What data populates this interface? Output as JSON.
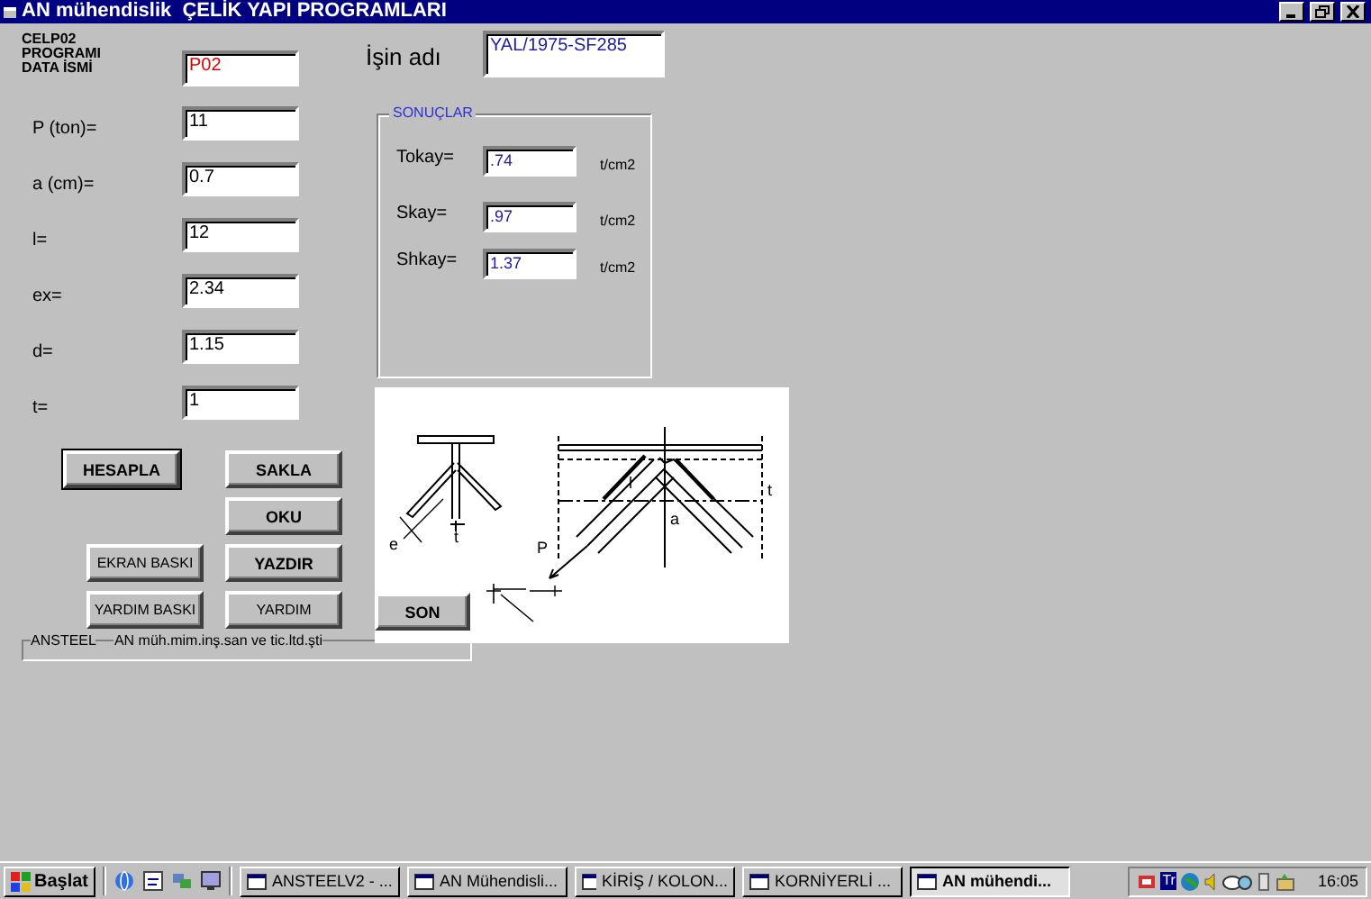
{
  "window": {
    "title": "AN mühendislik  ÇELİK YAPI PROGRAMLARI"
  },
  "data_name": {
    "label_lines": [
      "CELP02",
      "PROGRAMI",
      "DATA  İSMİ"
    ],
    "value": "P02"
  },
  "job_name": {
    "label": "İşin adı",
    "value": "YAL/1975-SF285"
  },
  "inputs": [
    {
      "label": "P (ton)=",
      "value": "11"
    },
    {
      "label": "a (cm)=",
      "value": "0.7"
    },
    {
      "label": "l=",
      "value": "12"
    },
    {
      "label": "ex=",
      "value": "2.34"
    },
    {
      "label": "d=",
      "value": "1.15"
    },
    {
      "label": "t=",
      "value": "1"
    }
  ],
  "results": {
    "title": "SONUÇLAR",
    "rows": [
      {
        "label": "Tokay=",
        "value": ".74",
        "unit": "t/cm2"
      },
      {
        "label": "Skay=",
        "value": ".97",
        "unit": "t/cm2"
      },
      {
        "label": "Shkay=",
        "value": "1.37",
        "unit": "t/cm2"
      }
    ]
  },
  "drawing": {
    "labels": [
      "e",
      "t",
      "l",
      "a",
      "t",
      "P"
    ]
  },
  "button_rows": [
    [
      {
        "label": "HESAPLA",
        "bold": true,
        "default": true
      },
      {
        "label": "SAKLA",
        "bold": true,
        "default": false
      }
    ],
    [
      {
        "label": "OKU",
        "bold": true,
        "default": false
      }
    ],
    [
      {
        "label": "EKRAN BASKI",
        "bold": false,
        "default": false
      },
      {
        "label": "YAZDIR",
        "bold": true,
        "default": false
      }
    ],
    [
      {
        "label": "YARDIM BASKI",
        "bold": false,
        "default": false
      },
      {
        "label": "YARDIM",
        "bold": false,
        "default": false
      }
    ]
  ],
  "son_button": {
    "label": "SON",
    "bold": true,
    "default": false
  },
  "status_frame": {
    "title": "ANSTEEL",
    "text": "AN müh.mim.inş.san ve tic.ltd.şti"
  },
  "taskbar": {
    "start": "Başlat",
    "tasks": [
      {
        "label": "ANSTEELV2 - ...",
        "selected": false
      },
      {
        "label": "AN Mühendisli...",
        "selected": false
      },
      {
        "label": "KİRİŞ / KOLON...",
        "selected": false
      },
      {
        "label": "KORNİYERLİ ...",
        "selected": false
      },
      {
        "label": "AN mühendi...",
        "selected": true
      }
    ],
    "language": "Tr",
    "clock": "16:05"
  }
}
